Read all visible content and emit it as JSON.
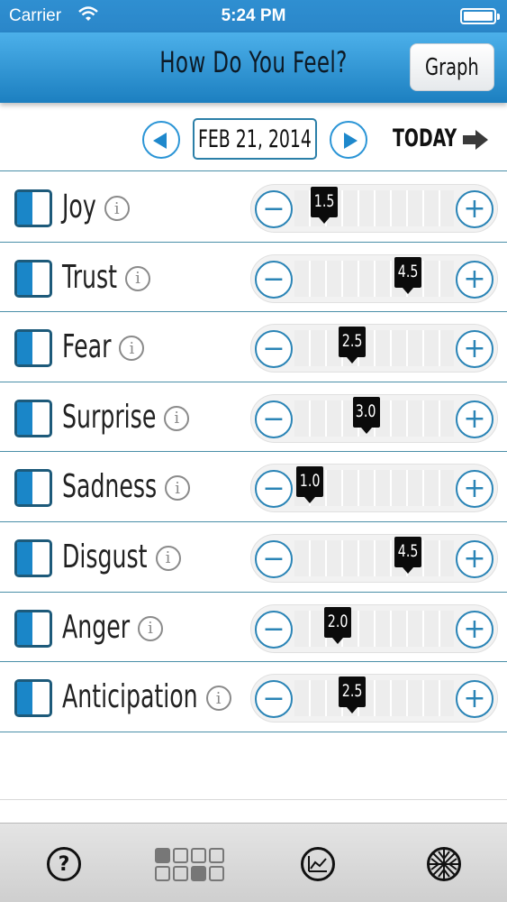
{
  "status_bar": {
    "carrier": "Carrier",
    "time": "5:24 PM"
  },
  "nav": {
    "title": "How Do You Feel?",
    "graph_button": "Graph"
  },
  "date_bar": {
    "date": "FEB 21, 2014",
    "today_label": "TODAY"
  },
  "emotions": [
    {
      "label": "Joy",
      "value": "1.5"
    },
    {
      "label": "Trust",
      "value": "4.5"
    },
    {
      "label": "Fear",
      "value": "2.5"
    },
    {
      "label": "Surprise",
      "value": "3.0"
    },
    {
      "label": "Sadness",
      "value": "1.0"
    },
    {
      "label": "Disgust",
      "value": "4.5"
    },
    {
      "label": "Anger",
      "value": "2.0"
    },
    {
      "label": "Anticipation",
      "value": "2.5"
    }
  ],
  "slider": {
    "min": 1.0,
    "max": 5.0
  },
  "tab_bar": {
    "items": [
      {
        "icon": "question-circle-icon"
      },
      {
        "icon": "grid-icon"
      },
      {
        "icon": "line-chart-icon"
      },
      {
        "icon": "emotion-wheel-icon"
      }
    ]
  },
  "colors": {
    "accent": "#1a86c8",
    "nav_top": "#4cb0ea",
    "nav_bottom": "#1c7fc0",
    "divider": "#4a8fa8"
  }
}
